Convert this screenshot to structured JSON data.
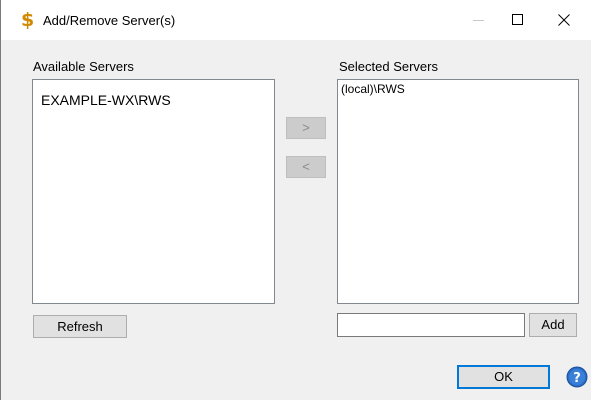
{
  "window": {
    "title": "Add/Remove Server(s)",
    "app_icon": "dollar-icon",
    "controls": [
      "minimize-icon",
      "maximize-icon",
      "close-icon"
    ]
  },
  "available": {
    "label": "Available Servers",
    "items": [
      "EXAMPLE-WX\\RWS"
    ]
  },
  "selected": {
    "label": "Selected Servers",
    "items": [
      "(local)\\RWS"
    ]
  },
  "buttons": {
    "move_right": ">",
    "move_left": "<",
    "refresh": "Refresh",
    "add": "Add",
    "ok": "OK"
  },
  "add_input": {
    "value": ""
  },
  "help_icon": "help-icon",
  "colors": {
    "accent": "#0078d7",
    "icon_gold": "#d08a00",
    "help_blue": "#2b6cc4"
  }
}
